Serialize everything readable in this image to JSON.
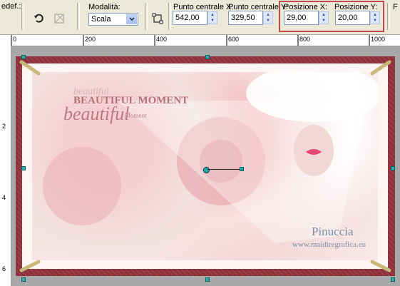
{
  "toolbar": {
    "preset_label": "edef.:",
    "mode_label": "Modalità:",
    "mode_value": "Scala",
    "center_x_label": "Punto centrale X:",
    "center_x_value": "542,00",
    "center_y_label": "Punto centrale Y:",
    "center_y_value": "329,50",
    "pos_x_label": "Posizione X:",
    "pos_x_value": "29,00",
    "pos_y_label": "Posizione Y:",
    "pos_y_value": "20,00",
    "edge_label": "F"
  },
  "ruler": {
    "top_ticks": [
      "0",
      "200",
      "400",
      "600",
      "800",
      "1000"
    ],
    "left_ticks": [
      "2",
      "4",
      "6"
    ]
  },
  "canvas": {
    "text_overlay": [
      "beautiful",
      "BEAUTIFUL MOMENT",
      "beautiful",
      "Moment"
    ],
    "watermark_name": "Pinuccia",
    "watermark_url": "www.maidiregrafica.eu",
    "frame_color": "#8e2f3a"
  },
  "icons": [
    "refresh-icon",
    "deform-icon",
    "select-rect-icon",
    "chevron-down-icon",
    "spin-up-icon",
    "spin-down-icon"
  ]
}
